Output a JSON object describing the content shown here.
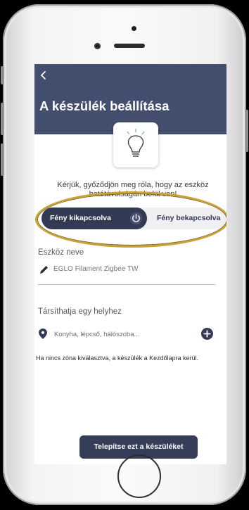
{
  "header": {
    "back_icon": "chevron-left-icon",
    "title": "A készülék beállítása"
  },
  "device": {
    "icon": "light-bulb-icon",
    "hint": "Kérjük, győződjön meg róla, hogy az eszköz hatótávolságán belül van!"
  },
  "light_toggle": {
    "off_label": "Fény kikapcsolva",
    "on_label": "Fény bekapcsolva",
    "selected": "off",
    "icon": "power-icon"
  },
  "device_name": {
    "label": "Eszköz neve",
    "value": "EGLO Filament Zigbee TW",
    "icon": "pencil-icon"
  },
  "location": {
    "label": "Társíthatja egy helyhez",
    "placeholder": "Konyha, lépcső, hálószoba...",
    "pin_icon": "location-pin-icon",
    "add_icon": "add-circle-icon",
    "note": "Ha nincs zóna kiválasztva, a készülék a Kezdőlapra kerül."
  },
  "install_button": {
    "label": "Telepítse ezt a készüléket"
  },
  "colors": {
    "header": "#444e6e",
    "toggle_active": "#333a54",
    "install_button": "#363d58",
    "highlight_ring": "#c9a33a"
  }
}
